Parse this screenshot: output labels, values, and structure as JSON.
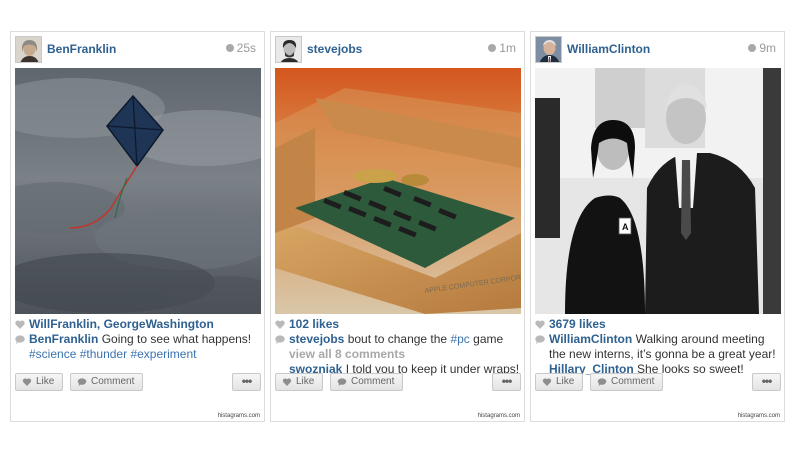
{
  "cards": [
    {
      "username": "BenFranklin",
      "time": "25s",
      "likes": "WillFranklin, GeorgeWashington",
      "comments": [
        {
          "user": "BenFranklin",
          "text": " Going to see what happens!",
          "tags": [
            "#science",
            "#thunder",
            "#experiment"
          ]
        }
      ],
      "like_label": "Like",
      "comment_label": "Comment",
      "more_label": "•••",
      "footer": "histagrams.com"
    },
    {
      "username": "stevejobs",
      "time": "1m",
      "likes": "102 likes",
      "comments": [
        {
          "user": "stevejobs",
          "text_before": " bout to change the ",
          "tag": "#pc",
          "text_after": " game"
        },
        {
          "view_all": "view all 8 comments"
        },
        {
          "user": "swozniak",
          "text": " I told you to keep it under wraps!"
        }
      ],
      "photo_caption": "APPLE COMPUTER CORPORATION",
      "like_label": "Like",
      "comment_label": "Comment",
      "more_label": "•••",
      "footer": "histagrams.com"
    },
    {
      "username": "WilliamClinton",
      "time": "9m",
      "likes": "3679 likes",
      "comments": [
        {
          "user": "WilliamClinton",
          "text": " Walking around meeting the new interns, it’s gonna be a great year!"
        },
        {
          "user": "Hillary_Clinton",
          "text": " She looks so sweet!"
        }
      ],
      "badge_letter": "A",
      "like_label": "Like",
      "comment_label": "Comment",
      "more_label": "•••",
      "footer": "histagrams.com"
    }
  ],
  "colors": {
    "username": "#2f6190",
    "hashtag": "#3a73b0",
    "border": "#dcdcdc"
  }
}
